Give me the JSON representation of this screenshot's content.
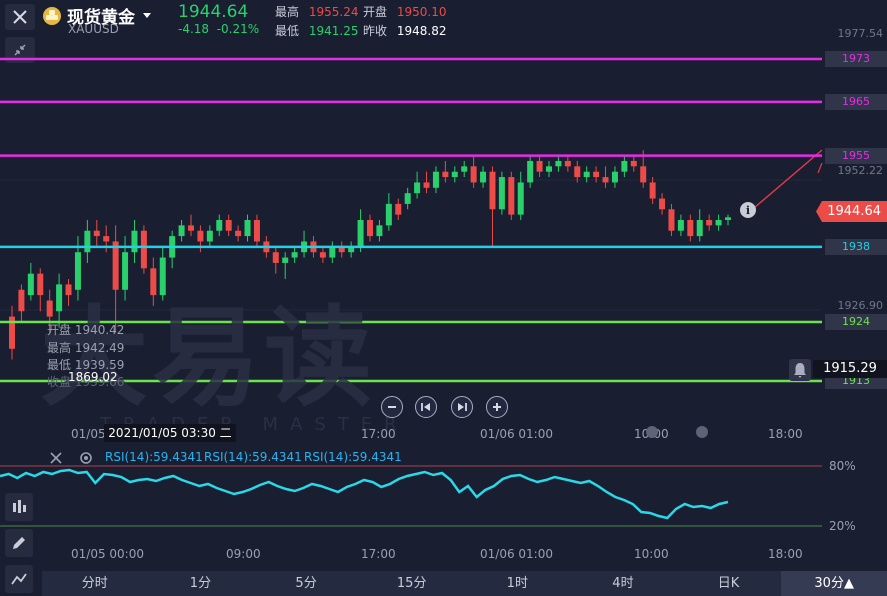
{
  "header": {
    "name": "现货黄金",
    "symbol": "XAUUSD",
    "price": "1944.64",
    "change": "-4.18",
    "change_pct": "-0.21%",
    "high_label": "最高",
    "high_value": "1955.24",
    "open_label": "开盘",
    "open_value": "1950.10",
    "low_label": "最低",
    "low_value": "1941.25",
    "prev_label": "昨收",
    "prev_value": "1948.82"
  },
  "price_axis": {
    "labels": [
      "1977.54",
      "1952.22",
      "1926.90"
    ],
    "current_price": "1944.64",
    "hover_price": "1915.29"
  },
  "price_lines": [
    {
      "label": "1973",
      "color": "#e62ce6"
    },
    {
      "label": "1965",
      "color": "#e62ce6"
    },
    {
      "label": "1955",
      "color": "#e62ce6"
    },
    {
      "label": "1938",
      "color": "#21d2e6"
    },
    {
      "label": "1924",
      "color": "#6be34a"
    },
    {
      "label": "1913",
      "color": "#6be34a"
    }
  ],
  "ohlc_overlay": {
    "open": "开盘 1940.42",
    "high": "最高 1942.49",
    "low": "最低 1939.59",
    "close": "收盘 1939.66",
    "low_marker": "1869.02"
  },
  "crosshair_time": "2021/01/05 03:30  二",
  "time_axis": [
    "01/05 00:00",
    "09:00",
    "17:00",
    "01/06 01:00",
    "10:00",
    "18:00"
  ],
  "watermark": {
    "text": "大易读",
    "sub": "TRADER MASTER"
  },
  "rsi": {
    "labels": [
      "RSI(14):59.4341",
      "RSI(14):59.4341",
      "RSI(14):59.4341"
    ],
    "level_high": "80%",
    "level_low": "20%"
  },
  "tabs": [
    "分时",
    "1分",
    "5分",
    "15分",
    "1时",
    "4时",
    "日K",
    "30分▲"
  ],
  "active_tab_index": 7,
  "colors": {
    "background": "#1a1e31",
    "up": "#2ad06c",
    "down": "#ec4b47",
    "rsi_line": "#2ad8e8"
  }
}
